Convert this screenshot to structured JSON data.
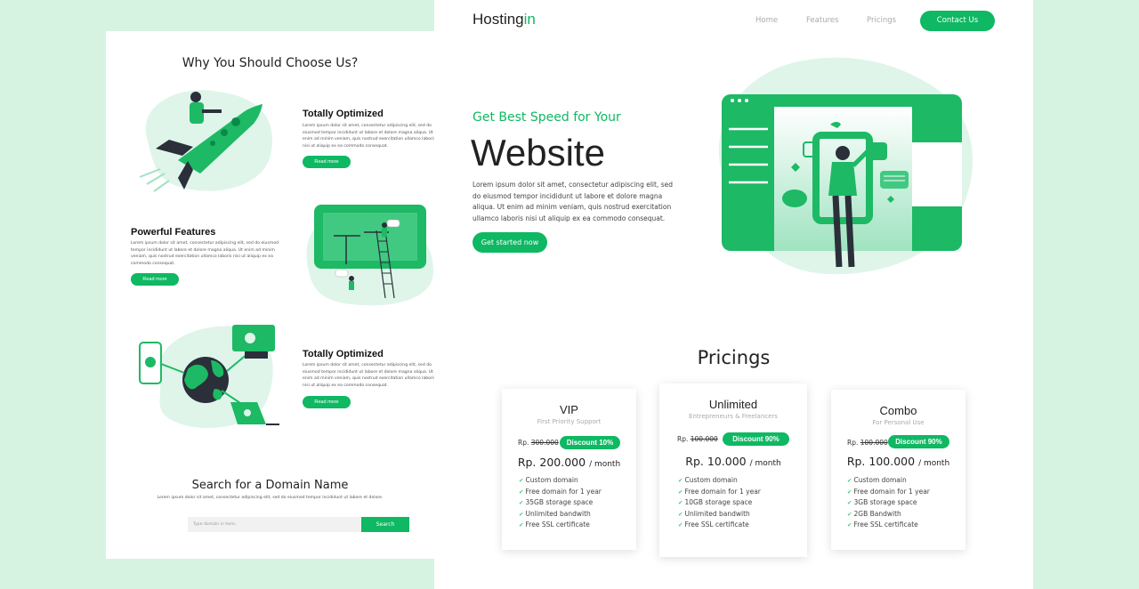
{
  "left": {
    "why_title": "Why You Should Choose Us?",
    "features": [
      {
        "title": "Totally Optimized",
        "desc": "Lorem ipsum dolor sit amet, consectetur adipiscing elit, sed do eiusmod tempor incididunt ut labore et dolore magna aliqua. Ut enim ad minim veniam, quis nostrud exercitation ullamco laboris nisi ut aliquip ex ea commodo consequat.",
        "button": "Read more"
      },
      {
        "title": "Powerful Features",
        "desc": "Lorem ipsum dolor sit amet, consectetur adipiscing elit, sed do eiusmod tempor incididunt ut labore et dolore magna aliqua. Ut enim ad minim veniam, quis nostrud exercitation ullamco laboris nisi ut aliquip ex ea commodo consequat.",
        "button": "Read more"
      },
      {
        "title": "Totally Optimized",
        "desc": "Lorem ipsum dolor sit amet, consectetur adipiscing elit, sed do eiusmod tempor incididunt ut labore et dolore magna aliqua. Ut enim ad minim veniam, quis nostrud exercitation ullamco laboris nisi ut aliquip ex ea commodo consequat.",
        "button": "Read more"
      }
    ],
    "domain_title": "Search for a Domain Name",
    "domain_desc": "Lorem ipsum dolor sit amet, consectetur adipiscing elit, sed do eiusmod tempor incididunt ut labore et dolore.",
    "domain_placeholder": "Type domain in here..",
    "domain_button": "Search"
  },
  "header": {
    "logo_main": "Hosting",
    "logo_accent": "in",
    "nav": [
      "Home",
      "Features",
      "Pricings"
    ],
    "contact": "Contact Us"
  },
  "hero": {
    "subtitle": "Get Best Speed for Your",
    "title": "Website",
    "desc": "Lorem ipsum dolor sit amet, consectetur adipiscing elit, sed do eiusmod tempor incididunt ut labore et dolore magna aliqua. Ut enim ad minim veniam, quis nostrud exercitation ullamco laboris nisi ut aliquip ex ea commodo consequat.",
    "button": "Get started now"
  },
  "pricing": {
    "title": "Pricings",
    "plans": [
      {
        "name": "VIP",
        "tagline": "First Priority Support",
        "old_prefix": "Rp.",
        "old_price": "300.000",
        "discount": "Discount 10%",
        "price": "Rp. 200.000",
        "period": "/ month",
        "features": [
          "Custom domain",
          "Free domain for 1 year",
          "35GB storage space",
          "Unlimited bandwith",
          "Free SSL certificate"
        ]
      },
      {
        "name": "Unlimited",
        "tagline": "Entrepreneurs & Freelancers",
        "old_prefix": "Rp.",
        "old_price": "100.000",
        "discount": "Discount 90%",
        "price": "Rp. 10.000",
        "period": "/ month",
        "features": [
          "Custom domain",
          "Free domain for 1 year",
          "10GB storage space",
          "Unlimited bandwith",
          "Free SSL certificate"
        ]
      },
      {
        "name": "Combo",
        "tagline": "For Personal Use",
        "old_prefix": "Rp.",
        "old_price": "100.000",
        "discount": "Discount 90%",
        "price": "Rp. 100.000",
        "period": "/ month",
        "features": [
          "Custom domain",
          "Free domain for 1 year",
          "3GB storage space",
          "2GB Bandwith",
          "Free SSL certificate"
        ]
      }
    ]
  },
  "colors": {
    "accent": "#0fb863",
    "background": "#d6f3e2",
    "blob": "#dff5e9"
  }
}
